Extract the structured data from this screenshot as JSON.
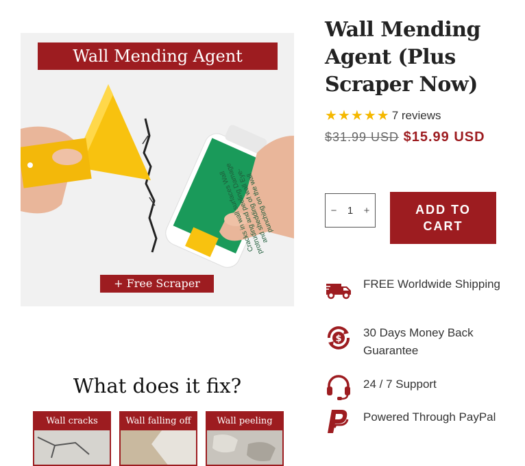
{
  "media": {
    "image_banner": "Wall Mending Agent",
    "image_footer": "+ Free Scraper",
    "tube_text": "Cracks in wall surfaces Wall protruding and peeling Damage and shedding of wall Eye-punching on the wall",
    "fix_heading": "What does it fix?",
    "fix_tiles": [
      {
        "label": "Wall cracks"
      },
      {
        "label": "Wall falling off"
      },
      {
        "label": "Wall peeling"
      }
    ]
  },
  "product": {
    "title": "Wall Mending Agent (Plus Scraper Now)",
    "rating_stars": 5,
    "reviews_label": "7 reviews",
    "compare_price": "$31.99 USD",
    "sale_price": "$15.99 USD",
    "quantity": "1",
    "qty_minus": "−",
    "qty_plus": "+",
    "add_to_cart": "ADD TO CART"
  },
  "features": [
    {
      "icon": "delivery-truck-icon",
      "text": "FREE Worldwide Shipping"
    },
    {
      "icon": "money-back-icon",
      "text": "30 Days Money Back Guarantee"
    },
    {
      "icon": "headset-icon",
      "text": "24 / 7 Support"
    },
    {
      "icon": "paypal-icon",
      "text": "Powered Through PayPal"
    }
  ],
  "colors": {
    "brand": "#9d1c20",
    "star": "#f5b800",
    "tile_border": "#9d1c20"
  }
}
